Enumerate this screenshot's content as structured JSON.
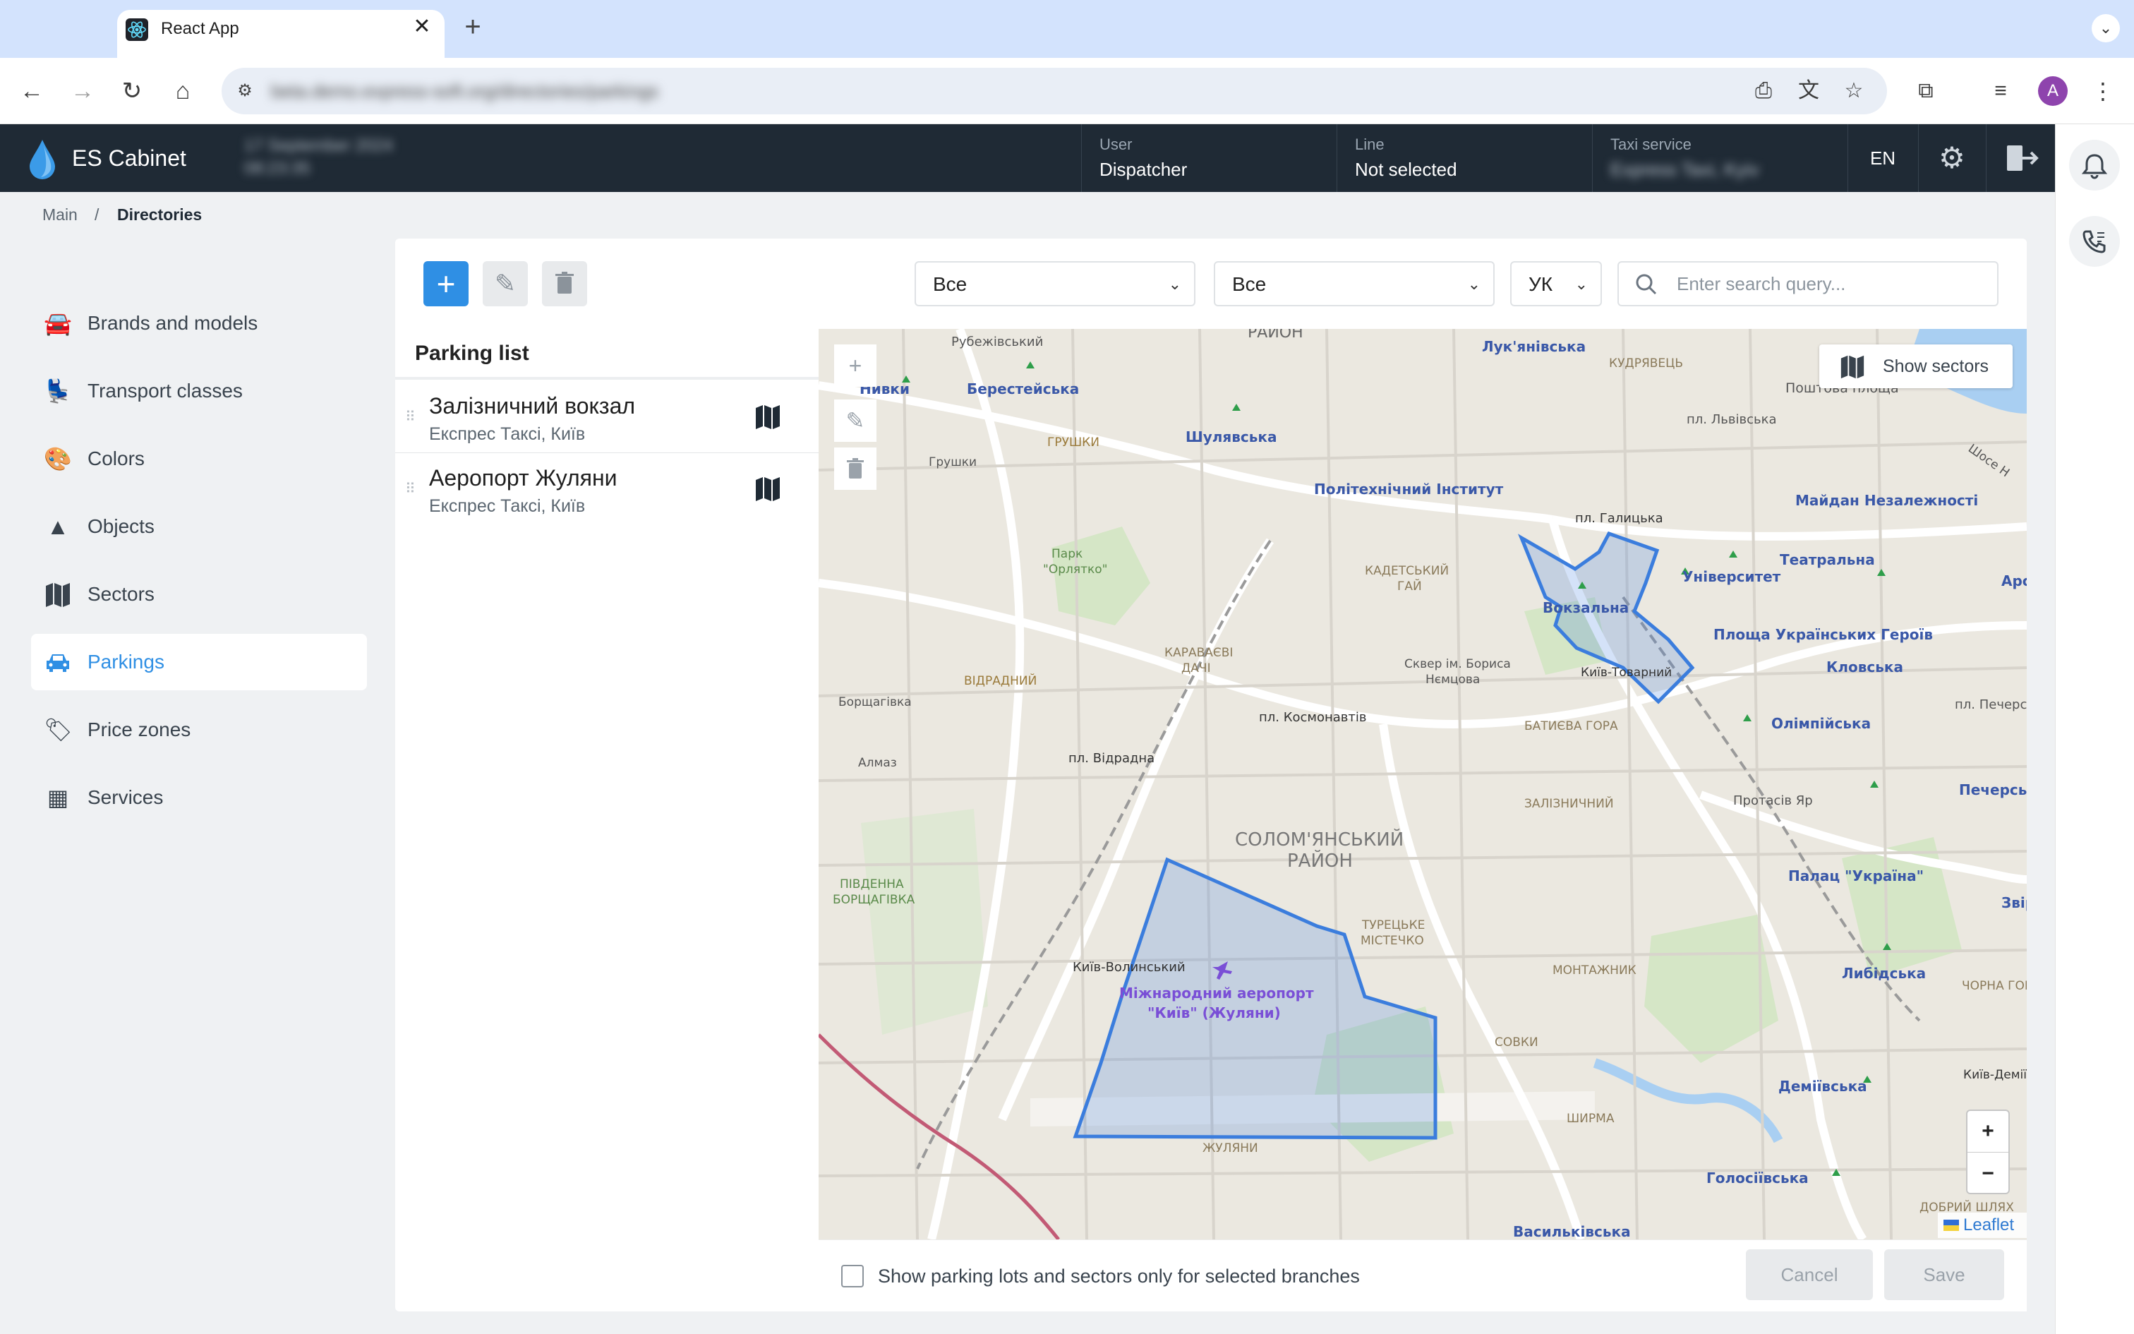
{
  "browser": {
    "tab_title": "React App",
    "tab_close": "✕",
    "new_tab": "+",
    "url": "beta.demo.express-soft.org/directories/parkings"
  },
  "header": {
    "app_name": "ES Cabinet",
    "date": "17 September 2024",
    "time": "08:23:35",
    "user_label": "User",
    "user_value": "Dispatcher",
    "line_label": "Line",
    "line_value": "Not selected",
    "taxi_label": "Taxi service",
    "taxi_value": "Express Taxi, Kyiv",
    "language": "EN"
  },
  "breadcrumb": {
    "main": "Main",
    "separator": "/",
    "current": "Directories"
  },
  "sidebar": {
    "items": [
      {
        "label": "Brands and models",
        "icon": "car-cog-icon"
      },
      {
        "label": "Transport classes",
        "icon": "car-seat-icon"
      },
      {
        "label": "Colors",
        "icon": "palette-icon"
      },
      {
        "label": "Objects",
        "icon": "shapes-icon"
      },
      {
        "label": "Sectors",
        "icon": "map-icon"
      },
      {
        "label": "Parkings",
        "icon": "car-icon",
        "active": true
      },
      {
        "label": "Price zones",
        "icon": "price-tag-icon"
      },
      {
        "label": "Services",
        "icon": "grid-icon"
      }
    ]
  },
  "toolbar": {
    "filter1": "Все",
    "filter2": "Все",
    "language_filter": "УК",
    "search_placeholder": "Enter search query..."
  },
  "parking_list": {
    "title": "Parking list",
    "items": [
      {
        "name": "Залізничний вокзал",
        "company": "Експрес Таксі, Київ"
      },
      {
        "name": "Аеропорт Жуляни",
        "company": "Експрес Таксі, Київ"
      }
    ]
  },
  "map": {
    "show_sectors_label": "Show sectors",
    "zoom_in": "+",
    "zoom_out": "−",
    "attribution": "Leaflet",
    "polygon_color": "#3b7ddd",
    "labels": {
      "rayon_top": "РАЙОН",
      "rubizhivskyi": "Рубежівський",
      "nyvky": "Нивки",
      "berestejska": "Берестейська",
      "hrushky_caps": "ГРУШКИ",
      "hrushky": "Грушки",
      "shuliavska": "Шулявська",
      "luk": "Лук'янівська",
      "kudriavets": "КУДРЯВЕЦЬ",
      "poshtova": "Поштова площа",
      "lvivska": "пл. Львівська",
      "shose": "Шосе Н",
      "politekh": "Політехнічний Інститут",
      "maidan": "Майдан Незалежності",
      "halytska": "пл. Галицька",
      "teatralna": "Театральна",
      "universytet": "Університет",
      "ars": "Арс",
      "park1": "Парк",
      "park2": "\"Орлятко\"",
      "kadetskyi1": "КАДЕТСЬКИЙ",
      "kadetskyi2": "ГАЙ",
      "vokzalna": "Вокзальна",
      "ploshcha_ukr": "Площа Українських Героїв",
      "klovska": "Кловська",
      "kyiv_tovarnyi": "Київ-Товарний",
      "karavaievi1": "КАРАВАЄВІ",
      "karavaievi2": "ДАЧІ",
      "skver1": "Сквер ім. Бориса",
      "skver2": "Нємцова",
      "vidradnyi_caps": "ВІДРАДНИЙ",
      "borshchahivka": "Борщагівка",
      "kosmonavtiv": "пл. Космонавтів",
      "batieva": "БАТИЄВА ГОРА",
      "olimpiiska": "Олімпійська",
      "pl_pechersk": "пл. Печерс",
      "almaz": "Алмаз",
      "vidradna": "пл. Відрадна",
      "zaliznychnyi": "ЗАЛІЗНИЧНИЙ",
      "protasiv": "Протасів Яр",
      "pechersk": "Печерсь",
      "solomianskyi1": "СОЛОМ'ЯНСЬКИЙ",
      "solomianskyi2": "РАЙОН",
      "pivdenna1": "ПІВДЕННА",
      "pivdenna2": "БОРЩАГІВКА",
      "palats": "Палац \"Україна\"",
      "zvir": "Звір",
      "turetske1": "ТУРЕЦЬКЕ",
      "turetske2": "МІСТЕЧКО",
      "kyiv_volynskyi": "Київ-Волинський",
      "airport1": "Міжнародний аеропорт",
      "airport2": "\"Київ\" (Жуляни)",
      "montazhnyk": "МОНТАЖНИК",
      "lybidska": "Либідська",
      "chorna_hora": "ЧОРНА ГОРА",
      "sovky": "СОВКИ",
      "kyiv_demiivskyi": "Київ-Деміївськ",
      "demiivska": "Деміївська",
      "shyrma": "ШИРМА",
      "zhuliany": "ЖУЛЯНИ",
      "holosiivska": "Голосіївська",
      "dobryi_shliakh": "ДОБРИЙ ШЛЯХ",
      "vasylkivska": "Васильківська"
    }
  },
  "footer": {
    "checkbox_label": "Show parking lots and sectors only for selected branches",
    "cancel": "Cancel",
    "save": "Save"
  }
}
